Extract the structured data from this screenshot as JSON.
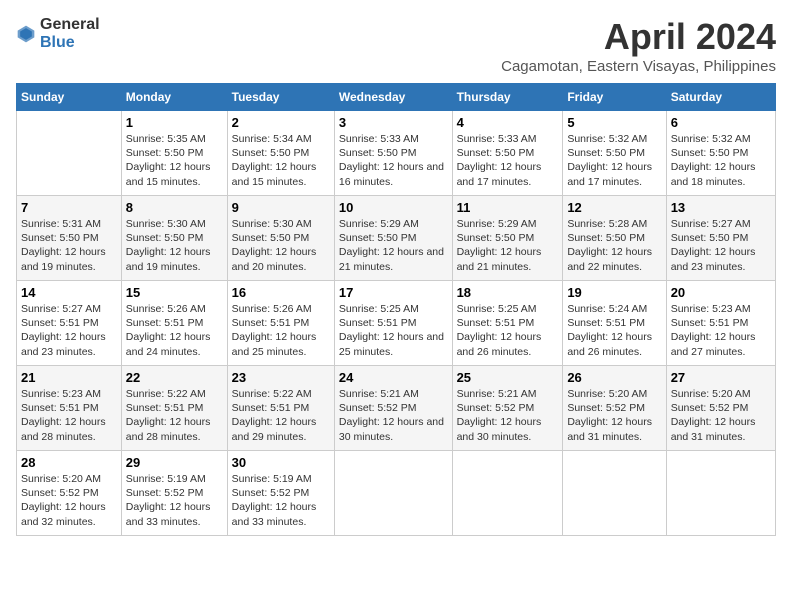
{
  "header": {
    "logo_general": "General",
    "logo_blue": "Blue",
    "title": "April 2024",
    "location": "Cagamotan, Eastern Visayas, Philippines"
  },
  "weekdays": [
    "Sunday",
    "Monday",
    "Tuesday",
    "Wednesday",
    "Thursday",
    "Friday",
    "Saturday"
  ],
  "weeks": [
    [
      {
        "day": "",
        "sunrise": "",
        "sunset": "",
        "daylight": ""
      },
      {
        "day": "1",
        "sunrise": "Sunrise: 5:35 AM",
        "sunset": "Sunset: 5:50 PM",
        "daylight": "Daylight: 12 hours and 15 minutes."
      },
      {
        "day": "2",
        "sunrise": "Sunrise: 5:34 AM",
        "sunset": "Sunset: 5:50 PM",
        "daylight": "Daylight: 12 hours and 15 minutes."
      },
      {
        "day": "3",
        "sunrise": "Sunrise: 5:33 AM",
        "sunset": "Sunset: 5:50 PM",
        "daylight": "Daylight: 12 hours and 16 minutes."
      },
      {
        "day": "4",
        "sunrise": "Sunrise: 5:33 AM",
        "sunset": "Sunset: 5:50 PM",
        "daylight": "Daylight: 12 hours and 17 minutes."
      },
      {
        "day": "5",
        "sunrise": "Sunrise: 5:32 AM",
        "sunset": "Sunset: 5:50 PM",
        "daylight": "Daylight: 12 hours and 17 minutes."
      },
      {
        "day": "6",
        "sunrise": "Sunrise: 5:32 AM",
        "sunset": "Sunset: 5:50 PM",
        "daylight": "Daylight: 12 hours and 18 minutes."
      }
    ],
    [
      {
        "day": "7",
        "sunrise": "Sunrise: 5:31 AM",
        "sunset": "Sunset: 5:50 PM",
        "daylight": "Daylight: 12 hours and 19 minutes."
      },
      {
        "day": "8",
        "sunrise": "Sunrise: 5:30 AM",
        "sunset": "Sunset: 5:50 PM",
        "daylight": "Daylight: 12 hours and 19 minutes."
      },
      {
        "day": "9",
        "sunrise": "Sunrise: 5:30 AM",
        "sunset": "Sunset: 5:50 PM",
        "daylight": "Daylight: 12 hours and 20 minutes."
      },
      {
        "day": "10",
        "sunrise": "Sunrise: 5:29 AM",
        "sunset": "Sunset: 5:50 PM",
        "daylight": "Daylight: 12 hours and 21 minutes."
      },
      {
        "day": "11",
        "sunrise": "Sunrise: 5:29 AM",
        "sunset": "Sunset: 5:50 PM",
        "daylight": "Daylight: 12 hours and 21 minutes."
      },
      {
        "day": "12",
        "sunrise": "Sunrise: 5:28 AM",
        "sunset": "Sunset: 5:50 PM",
        "daylight": "Daylight: 12 hours and 22 minutes."
      },
      {
        "day": "13",
        "sunrise": "Sunrise: 5:27 AM",
        "sunset": "Sunset: 5:50 PM",
        "daylight": "Daylight: 12 hours and 23 minutes."
      }
    ],
    [
      {
        "day": "14",
        "sunrise": "Sunrise: 5:27 AM",
        "sunset": "Sunset: 5:51 PM",
        "daylight": "Daylight: 12 hours and 23 minutes."
      },
      {
        "day": "15",
        "sunrise": "Sunrise: 5:26 AM",
        "sunset": "Sunset: 5:51 PM",
        "daylight": "Daylight: 12 hours and 24 minutes."
      },
      {
        "day": "16",
        "sunrise": "Sunrise: 5:26 AM",
        "sunset": "Sunset: 5:51 PM",
        "daylight": "Daylight: 12 hours and 25 minutes."
      },
      {
        "day": "17",
        "sunrise": "Sunrise: 5:25 AM",
        "sunset": "Sunset: 5:51 PM",
        "daylight": "Daylight: 12 hours and 25 minutes."
      },
      {
        "day": "18",
        "sunrise": "Sunrise: 5:25 AM",
        "sunset": "Sunset: 5:51 PM",
        "daylight": "Daylight: 12 hours and 26 minutes."
      },
      {
        "day": "19",
        "sunrise": "Sunrise: 5:24 AM",
        "sunset": "Sunset: 5:51 PM",
        "daylight": "Daylight: 12 hours and 26 minutes."
      },
      {
        "day": "20",
        "sunrise": "Sunrise: 5:23 AM",
        "sunset": "Sunset: 5:51 PM",
        "daylight": "Daylight: 12 hours and 27 minutes."
      }
    ],
    [
      {
        "day": "21",
        "sunrise": "Sunrise: 5:23 AM",
        "sunset": "Sunset: 5:51 PM",
        "daylight": "Daylight: 12 hours and 28 minutes."
      },
      {
        "day": "22",
        "sunrise": "Sunrise: 5:22 AM",
        "sunset": "Sunset: 5:51 PM",
        "daylight": "Daylight: 12 hours and 28 minutes."
      },
      {
        "day": "23",
        "sunrise": "Sunrise: 5:22 AM",
        "sunset": "Sunset: 5:51 PM",
        "daylight": "Daylight: 12 hours and 29 minutes."
      },
      {
        "day": "24",
        "sunrise": "Sunrise: 5:21 AM",
        "sunset": "Sunset: 5:52 PM",
        "daylight": "Daylight: 12 hours and 30 minutes."
      },
      {
        "day": "25",
        "sunrise": "Sunrise: 5:21 AM",
        "sunset": "Sunset: 5:52 PM",
        "daylight": "Daylight: 12 hours and 30 minutes."
      },
      {
        "day": "26",
        "sunrise": "Sunrise: 5:20 AM",
        "sunset": "Sunset: 5:52 PM",
        "daylight": "Daylight: 12 hours and 31 minutes."
      },
      {
        "day": "27",
        "sunrise": "Sunrise: 5:20 AM",
        "sunset": "Sunset: 5:52 PM",
        "daylight": "Daylight: 12 hours and 31 minutes."
      }
    ],
    [
      {
        "day": "28",
        "sunrise": "Sunrise: 5:20 AM",
        "sunset": "Sunset: 5:52 PM",
        "daylight": "Daylight: 12 hours and 32 minutes."
      },
      {
        "day": "29",
        "sunrise": "Sunrise: 5:19 AM",
        "sunset": "Sunset: 5:52 PM",
        "daylight": "Daylight: 12 hours and 33 minutes."
      },
      {
        "day": "30",
        "sunrise": "Sunrise: 5:19 AM",
        "sunset": "Sunset: 5:52 PM",
        "daylight": "Daylight: 12 hours and 33 minutes."
      },
      {
        "day": "",
        "sunrise": "",
        "sunset": "",
        "daylight": ""
      },
      {
        "day": "",
        "sunrise": "",
        "sunset": "",
        "daylight": ""
      },
      {
        "day": "",
        "sunrise": "",
        "sunset": "",
        "daylight": ""
      },
      {
        "day": "",
        "sunrise": "",
        "sunset": "",
        "daylight": ""
      }
    ]
  ]
}
